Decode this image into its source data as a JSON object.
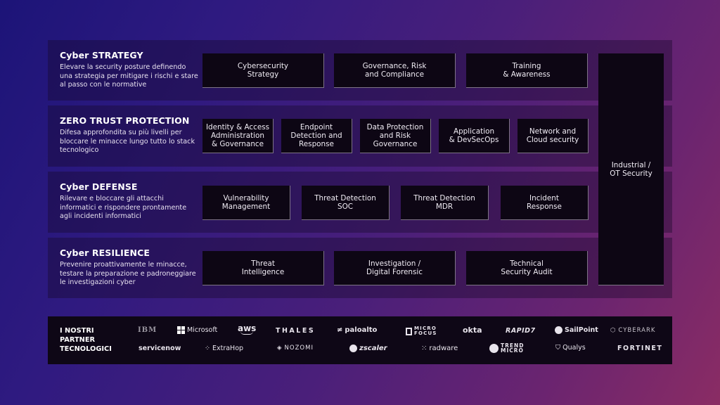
{
  "rows": [
    {
      "title": "Cyber STRATEGY",
      "description": "Elevare la security posture definendo una strategia per mitigare i rischi e stare al passo con le normative",
      "services": [
        "Cybersecurity\nStrategy",
        "Governance, Risk\nand Compliance",
        "Training\n& Awareness"
      ]
    },
    {
      "title": "ZERO TRUST PROTECTION",
      "description": "Difesa approfondita su più livelli per bloccare le minacce lungo tutto lo stack tecnologico",
      "services": [
        "Identity & Access\nAdministration\n& Governance",
        "Endpoint\nDetection and\nResponse",
        "Data Protection\nand Risk\nGovernance",
        "Application\n& DevSecOps",
        "Network and\nCloud security"
      ]
    },
    {
      "title": "Cyber DEFENSE",
      "description": "Rilevare e bloccare gli attacchi informatici e rispondere prontamente agli incidenti informatici",
      "services": [
        "Vulnerability\nManagement",
        "Threat Detection\nSOC",
        "Threat Detection\nMDR",
        "Incident\nResponse"
      ]
    },
    {
      "title": "Cyber RESILIENCE",
      "description": "Prevenire proattivamente le minacce, testare la preparazione e padroneggiare le investigazioni cyber",
      "services": [
        "Threat\nIntelligence",
        "Investigation /\nDigital Forensic",
        "Technical\nSecurity Audit"
      ]
    }
  ],
  "side_pillar": "Industrial /\nOT Security",
  "partners": {
    "title": "I NOSTRI\nPARTNER\nTECNOLOGICI",
    "row1": [
      "IBM",
      "Microsoft",
      "aws",
      "THALES",
      "paloalto",
      "MICRO\nFOCUS",
      "okta",
      "RAPID7",
      "SailPoint",
      "CYBERARK"
    ],
    "row2": [
      "servicenow",
      "ExtraHop",
      "NOZOMI",
      "zscaler",
      "radware",
      "TREND\nMICRO",
      "Qualys",
      "FORTINET"
    ]
  },
  "colors": {
    "box_bg": "#0d0614",
    "gradient_start": "#1c1478",
    "gradient_end": "#8a2c64"
  }
}
